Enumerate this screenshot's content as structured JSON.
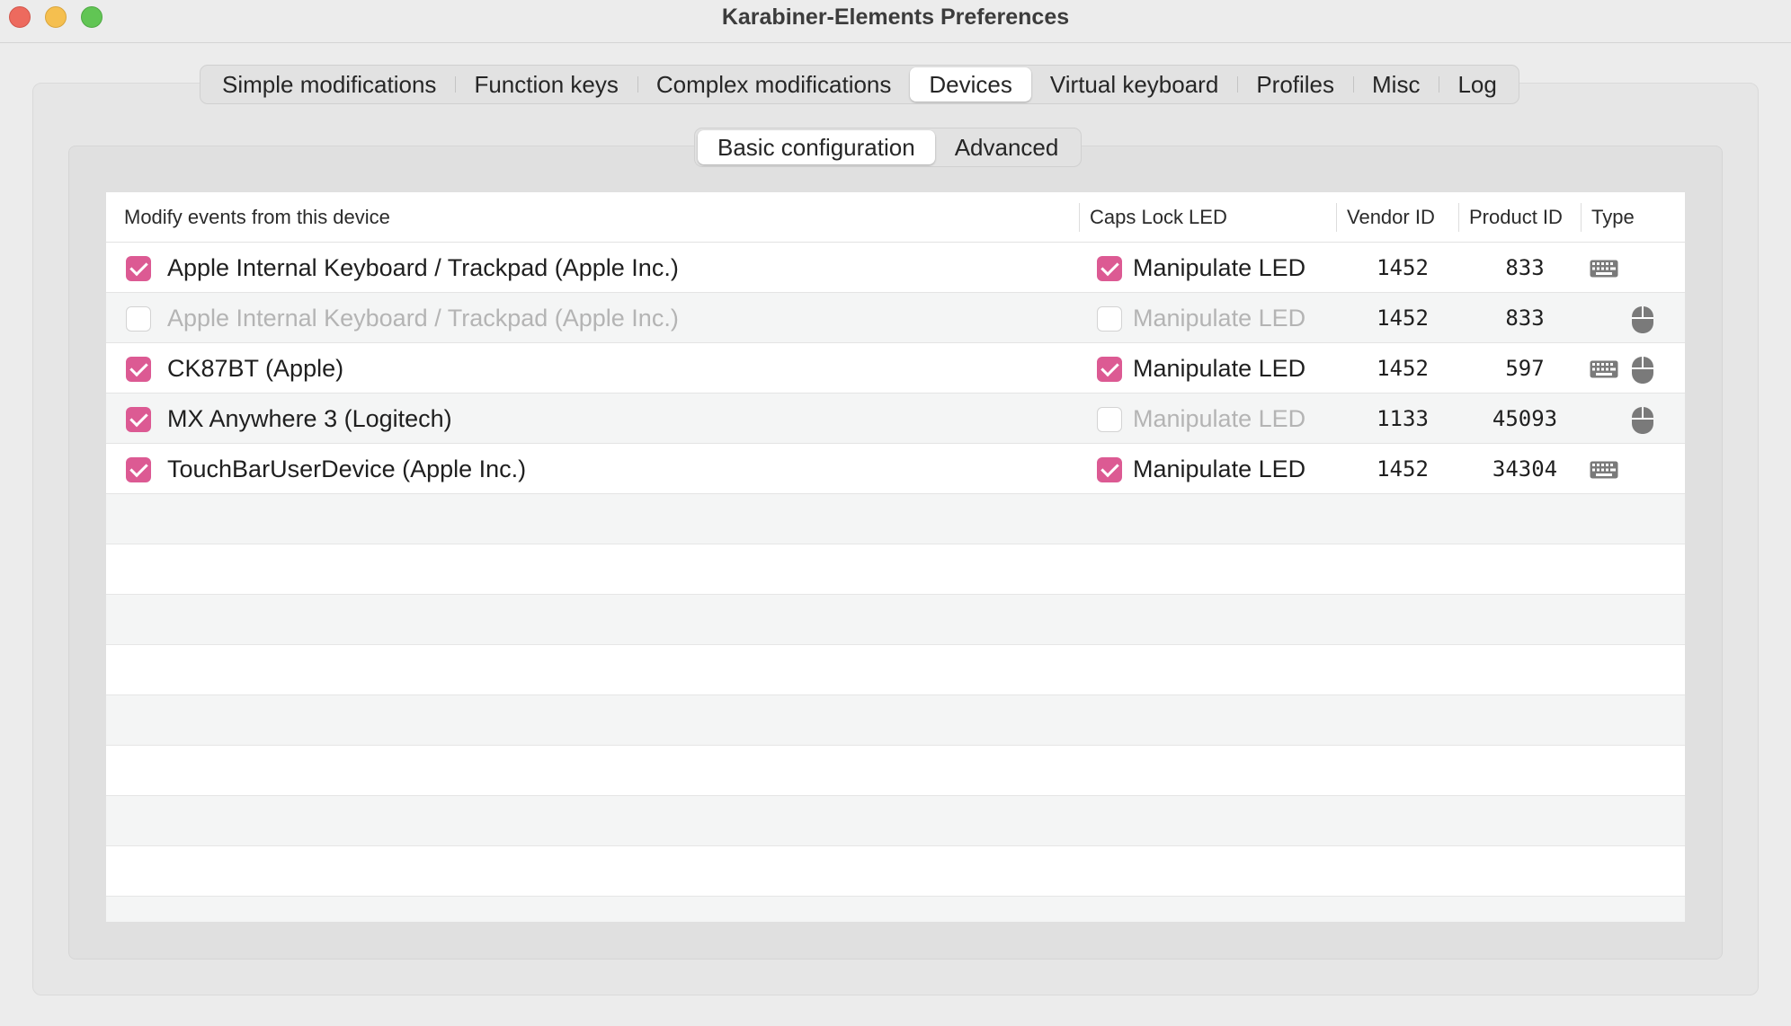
{
  "window": {
    "title": "Karabiner-Elements Preferences"
  },
  "main_tabs": [
    {
      "label": "Simple modifications",
      "active": false
    },
    {
      "label": "Function keys",
      "active": false
    },
    {
      "label": "Complex modifications",
      "active": false
    },
    {
      "label": "Devices",
      "active": true
    },
    {
      "label": "Virtual keyboard",
      "active": false
    },
    {
      "label": "Profiles",
      "active": false
    },
    {
      "label": "Misc",
      "active": false
    },
    {
      "label": "Log",
      "active": false
    }
  ],
  "sub_tabs": [
    {
      "label": "Basic configuration",
      "active": true
    },
    {
      "label": "Advanced",
      "active": false
    }
  ],
  "table": {
    "headers": {
      "device": "Modify events from this device",
      "caps_lock": "Caps Lock LED",
      "vendor_id": "Vendor ID",
      "product_id": "Product ID",
      "type": "Type"
    },
    "rows": [
      {
        "device": "Apple Internal Keyboard / Trackpad (Apple Inc.)",
        "modify": true,
        "modify_enabled": true,
        "led_label": "Manipulate LED",
        "led": true,
        "led_enabled": true,
        "vendor_id": "1452",
        "product_id": "833",
        "keyboard": true,
        "pointing": false
      },
      {
        "device": "Apple Internal Keyboard / Trackpad (Apple Inc.)",
        "modify": false,
        "modify_enabled": false,
        "led_label": "Manipulate LED",
        "led": false,
        "led_enabled": false,
        "vendor_id": "1452",
        "product_id": "833",
        "keyboard": false,
        "pointing": true
      },
      {
        "device": "CK87BT (Apple)",
        "modify": true,
        "modify_enabled": true,
        "led_label": "Manipulate LED",
        "led": true,
        "led_enabled": true,
        "vendor_id": "1452",
        "product_id": "597",
        "keyboard": true,
        "pointing": true
      },
      {
        "device": "MX Anywhere 3 (Logitech)",
        "modify": true,
        "modify_enabled": true,
        "led_label": "Manipulate LED",
        "led": false,
        "led_enabled": false,
        "vendor_id": "1133",
        "product_id": "45093",
        "keyboard": false,
        "pointing": true
      },
      {
        "device": "TouchBarUserDevice (Apple Inc.)",
        "modify": true,
        "modify_enabled": true,
        "led_label": "Manipulate LED",
        "led": true,
        "led_enabled": true,
        "vendor_id": "1452",
        "product_id": "34304",
        "keyboard": true,
        "pointing": false
      }
    ],
    "icons": {
      "keyboard": "keyboard-icon",
      "pointing": "mouse-icon"
    }
  },
  "colors": {
    "accent": "#dc5a93",
    "disabled_text": "#b4b4b4",
    "icon_gray": "#7a7a7a"
  }
}
